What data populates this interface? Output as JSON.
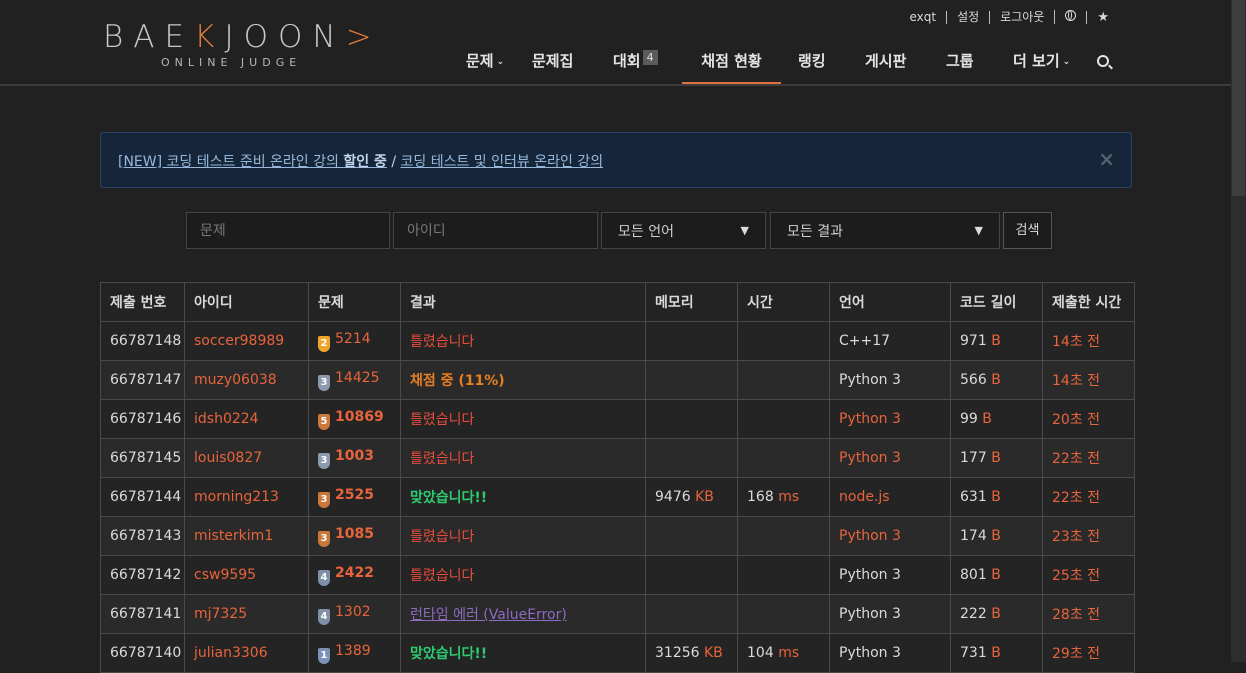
{
  "logo": {
    "main_a": "BAE",
    "main_k": "K",
    "main_b": "JOON",
    "sub": "ONLINE JUDGE"
  },
  "util": {
    "user": "exqt",
    "settings": "설정",
    "logout": "로그아웃"
  },
  "nav": {
    "problems": "문제",
    "workbook": "문제집",
    "contest": "대회",
    "contest_badge": "4",
    "status": "채점 현황",
    "ranking": "랭킹",
    "board": "게시판",
    "groups": "그룹",
    "more": "더 보기"
  },
  "alert": {
    "link1_prefix": "[NEW] 코딩 테스트 준비 온라인 강의 ",
    "link1_bold": "할인 중",
    "separator": " / ",
    "link2": "코딩 테스트 및 인터뷰 온라인 강의",
    "close": "×"
  },
  "filter": {
    "problem_placeholder": "문제",
    "user_placeholder": "아이디",
    "language_value": "모든 언어",
    "result_value": "모든 결과",
    "search_label": "검색"
  },
  "table": {
    "headers": [
      "제출 번호",
      "아이디",
      "문제",
      "결과",
      "메모리",
      "시간",
      "언어",
      "코드 길이",
      "제출한 시간"
    ],
    "rows": [
      {
        "id": "66787148",
        "user": "soccer98989",
        "tier": "2",
        "problem": "5214",
        "result": "틀렸습니다",
        "memory": "",
        "memory_unit": "",
        "time": "",
        "time_unit": "",
        "lang": "C++17",
        "length": "971",
        "length_unit": "B",
        "submitted": "14초 전"
      },
      {
        "id": "66787147",
        "user": "muzy06038",
        "tier": "3",
        "problem": "14425",
        "result": "채점 중 (11%)",
        "memory": "",
        "memory_unit": "",
        "time": "",
        "time_unit": "",
        "lang": "Python 3",
        "length": "566",
        "length_unit": "B",
        "submitted": "14초 전"
      },
      {
        "id": "66787146",
        "user": "idsh0224",
        "tier": "5",
        "problem": "10869",
        "result": "틀렸습니다",
        "memory": "",
        "memory_unit": "",
        "time": "",
        "time_unit": "",
        "lang": "Python 3",
        "length": "99",
        "length_unit": "B",
        "submitted": "20초 전"
      },
      {
        "id": "66787145",
        "user": "louis0827",
        "tier": "3",
        "problem": "1003",
        "result": "틀렸습니다",
        "memory": "",
        "memory_unit": "",
        "time": "",
        "time_unit": "",
        "lang": "Python 3",
        "length": "177",
        "length_unit": "B",
        "submitted": "22초 전"
      },
      {
        "id": "66787144",
        "user": "morning213",
        "tier": "3",
        "problem": "2525",
        "result": "맞았습니다!!",
        "memory": "9476",
        "memory_unit": "KB",
        "time": "168",
        "time_unit": "ms",
        "lang": "node.js",
        "length": "631",
        "length_unit": "B",
        "submitted": "22초 전"
      },
      {
        "id": "66787143",
        "user": "misterkim1",
        "tier": "3",
        "problem": "1085",
        "result": "틀렸습니다",
        "memory": "",
        "memory_unit": "",
        "time": "",
        "time_unit": "",
        "lang": "Python 3",
        "length": "174",
        "length_unit": "B",
        "submitted": "23초 전"
      },
      {
        "id": "66787142",
        "user": "csw9595",
        "tier": "4",
        "problem": "2422",
        "result": "틀렸습니다",
        "memory": "",
        "memory_unit": "",
        "time": "",
        "time_unit": "",
        "lang": "Python 3",
        "length": "801",
        "length_unit": "B",
        "submitted": "25초 전"
      },
      {
        "id": "66787141",
        "user": "mj7325",
        "tier": "4",
        "problem": "1302",
        "result": "런타임 에러 (ValueError)",
        "memory": "",
        "memory_unit": "",
        "time": "",
        "time_unit": "",
        "lang": "Python 3",
        "length": "222",
        "length_unit": "B",
        "submitted": "28초 전"
      },
      {
        "id": "66787140",
        "user": "julian3306",
        "tier": "1",
        "problem": "1389",
        "result": "맞았습니다!!",
        "memory": "31256",
        "memory_unit": "KB",
        "time": "104",
        "time_unit": "ms",
        "lang": "Python 3",
        "length": "731",
        "length_unit": "B",
        "submitted": "29초 전"
      }
    ]
  }
}
